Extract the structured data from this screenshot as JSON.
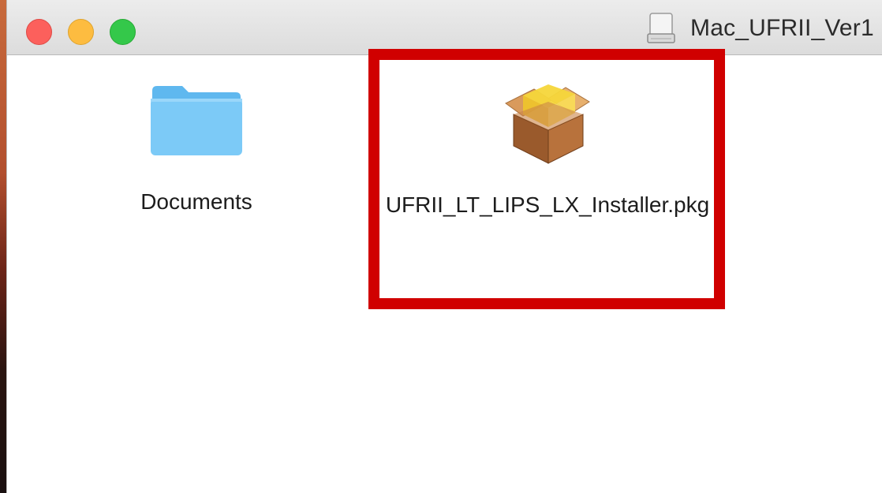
{
  "window": {
    "title": "Mac_UFRII_Ver1"
  },
  "items": [
    {
      "label": "Documents",
      "icon": "folder-icon"
    },
    {
      "label": "UFRII_LT_LIPS_LX_Installer.pkg",
      "icon": "package-icon"
    }
  ],
  "colors": {
    "highlight": "#d00000",
    "folder": "#6cc2f5",
    "close": "#fc605c",
    "minimize": "#fdbc40",
    "zoom": "#34c84a"
  }
}
